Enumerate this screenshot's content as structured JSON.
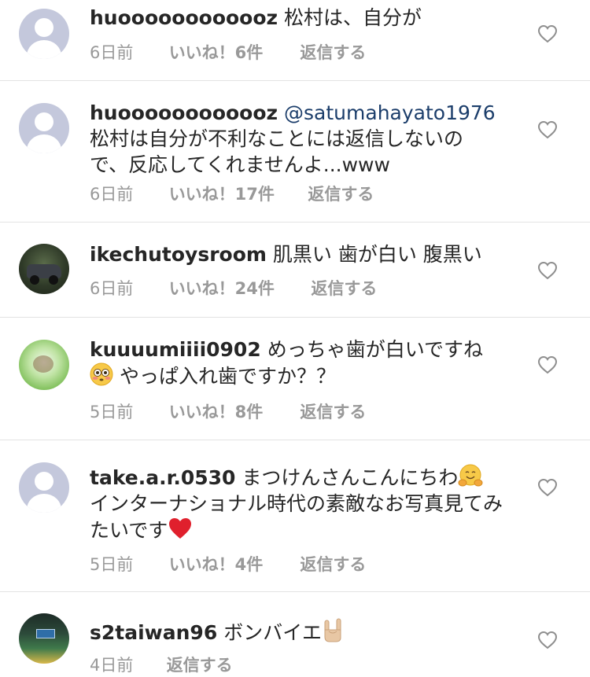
{
  "comments": [
    {
      "username": "huoooooooooooz",
      "mention": "",
      "text": "松村は、自分が",
      "time": "6日前",
      "likes": "いいね！6件",
      "reply": "返信する",
      "avatar": "default-avatar"
    },
    {
      "username": "huoooooooooooz",
      "mention": "@satumahayato1976",
      "text": "松村は自分が不利なことには返信しないので、反応してくれませんよ...www",
      "time": "6日前",
      "likes": "いいね！17件",
      "reply": "返信する",
      "avatar": "default-avatar"
    },
    {
      "username": "ikechutoysroom",
      "mention": "",
      "text": "肌黒い 歯が白い 腹黒い",
      "time": "6日前",
      "likes": "いいね！24件",
      "reply": "返信する",
      "avatar": "car-photo-avatar"
    },
    {
      "username": "kuuuumiiii0902",
      "mention": "",
      "text": "めっちゃ歯が白いですね",
      "text2": "やっぱ入れ歯ですか？？",
      "emoji": "flushed-face-emoji",
      "time": "5日前",
      "likes": "いいね！8件",
      "reply": "返信する",
      "avatar": "nature-photo-avatar"
    },
    {
      "username": "take.a.r.0530",
      "mention": "",
      "text": "まつけんさんこんにちわ",
      "text2": "インターナショナル時代の素敵なお写真見てみたいです",
      "emoji": "hugging-face-emoji",
      "emoji2": "red-heart-emoji",
      "time": "5日前",
      "likes": "いいね！4件",
      "reply": "返信する",
      "avatar": "default-avatar"
    },
    {
      "username": "s2taiwan96",
      "mention": "",
      "text": "ボンバイエ",
      "emoji": "sign-of-the-horns-emoji",
      "time": "4日前",
      "likes": "",
      "reply": "返信する",
      "avatar": "stadium-photo-avatar"
    }
  ],
  "colors": {
    "text": "#262626",
    "meta": "#999999",
    "mention": "#1c3e6b",
    "divider": "#e3e3e3",
    "heart_outline": "#8e8e8e"
  },
  "icons": {
    "like": "heart-outline-icon"
  }
}
